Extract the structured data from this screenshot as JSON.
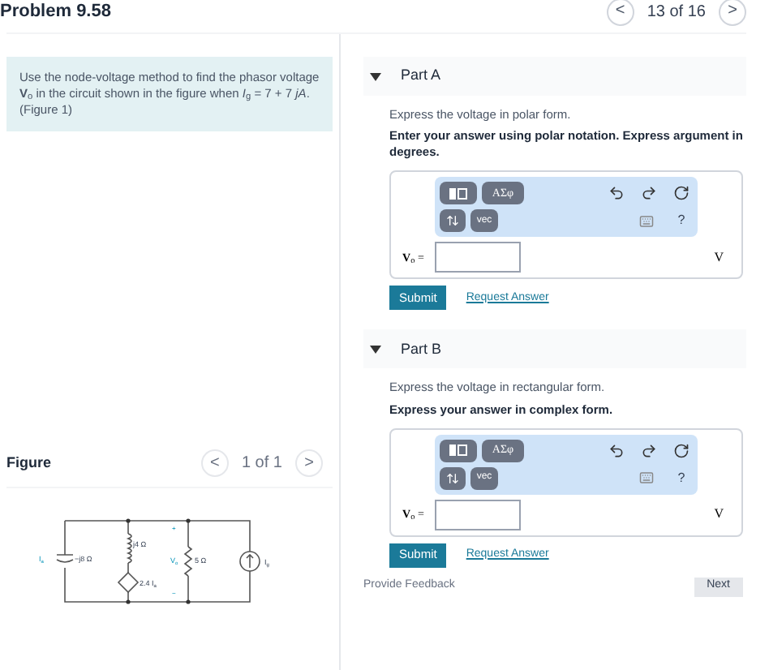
{
  "header": {
    "title": "Problem 9.58",
    "pager": {
      "prev": "<",
      "position": "13 of 16",
      "next": ">"
    }
  },
  "problem": {
    "text": "Use the node-voltage method to find the phasor voltage **V**$_{o}$ in the circuit shown in the figure when *I*$_{g}$ = 7 + 7 *jA*.(Figure 1)"
  },
  "figure": {
    "title": "Figure",
    "pager": {
      "prev": "<",
      "position": "1 of 1",
      "next": ">"
    },
    "labels": {
      "inductor": "j4 Ω",
      "capacitor": "−j8 Ω",
      "source_current": "I",
      "source_sub": "g",
      "cap_current": "I",
      "cap_sub": "a",
      "dependent": "2.4 I",
      "dependent_sub": "a",
      "voltage": "V",
      "voltage_sub": "o",
      "resistor": "5 Ω",
      "plus": "+",
      "minus": "−"
    }
  },
  "parts": [
    {
      "title": "Part A",
      "expanded": true,
      "instruction": "Express the voltage in polar form.",
      "hint": "Enter your answer using polar notation. Express argument in degrees.",
      "toolbar": {
        "greek": "ΑΣφ",
        "vec": "vec",
        "help": "?"
      },
      "answer_label": "**V**$_{o}$ =",
      "unit": "V",
      "submit": "Submit",
      "request": "Request Answer"
    },
    {
      "title": "Part B",
      "expanded": true,
      "instruction": "Express the voltage in rectangular form.",
      "hint": "Express your answer in complex form.",
      "toolbar": {
        "greek": "ΑΣφ",
        "vec": "vec",
        "help": "?"
      },
      "answer_label": "**V**$_{o}$ =",
      "unit": "V",
      "submit": "Submit",
      "request": "Request Answer"
    }
  ],
  "footer": {
    "feedback": "Provide Feedback",
    "next": "Next"
  }
}
